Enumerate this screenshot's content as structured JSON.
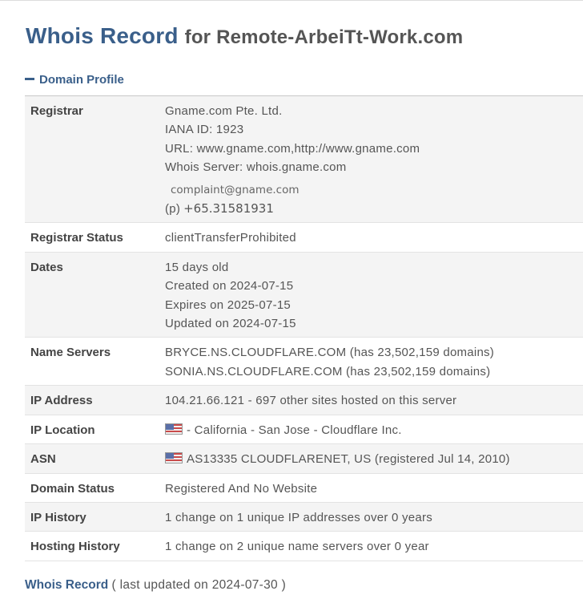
{
  "header": {
    "title_main": "Whois Record",
    "title_for": "for Remote-ArbeiTt-Work.com"
  },
  "section": {
    "label": "Domain Profile"
  },
  "registrar": {
    "label": "Registrar",
    "name": "Gname.com Pte. Ltd.",
    "iana": "IANA ID: 1923",
    "url": "URL: www.gname.com,http://www.gname.com",
    "whois_server": "Whois Server: whois.gname.com",
    "email": "complaint@gname.com",
    "phone_prefix": "(p)",
    "phone": "+65.31581931"
  },
  "registrar_status": {
    "label": "Registrar Status",
    "value": "clientTransferProhibited"
  },
  "dates": {
    "label": "Dates",
    "age": "15 days old",
    "created": "Created on 2024-07-15",
    "expires": "Expires on 2025-07-15",
    "updated": "Updated on 2024-07-15"
  },
  "name_servers": {
    "label": "Name Servers",
    "ns1": "BRYCE.NS.CLOUDFLARE.COM (has 23,502,159 domains)",
    "ns2": "SONIA.NS.CLOUDFLARE.COM (has 23,502,159 domains)"
  },
  "ip_address": {
    "label": "IP Address",
    "value": "104.21.66.121 - 697 other sites hosted on this server"
  },
  "ip_location": {
    "label": "IP Location",
    "flag_icon": "us-flag-icon",
    "value": "- California - San Jose - Cloudflare Inc."
  },
  "asn": {
    "label": "ASN",
    "flag_icon": "us-flag-icon",
    "value": "AS13335 CLOUDFLARENET, US (registered Jul 14, 2010)"
  },
  "domain_status": {
    "label": "Domain Status",
    "value": "Registered And No Website"
  },
  "ip_history": {
    "label": "IP History",
    "value": "1 change on 1 unique IP addresses over 0 years"
  },
  "hosting_history": {
    "label": "Hosting History",
    "value": "1 change on 2 unique name servers over 0 year"
  },
  "footer": {
    "title": "Whois Record",
    "note": "( last updated on 2024-07-30 )"
  },
  "colors": {
    "accent": "#3a5f8a",
    "row_alt": "#f4f4f4",
    "text": "#555555"
  }
}
